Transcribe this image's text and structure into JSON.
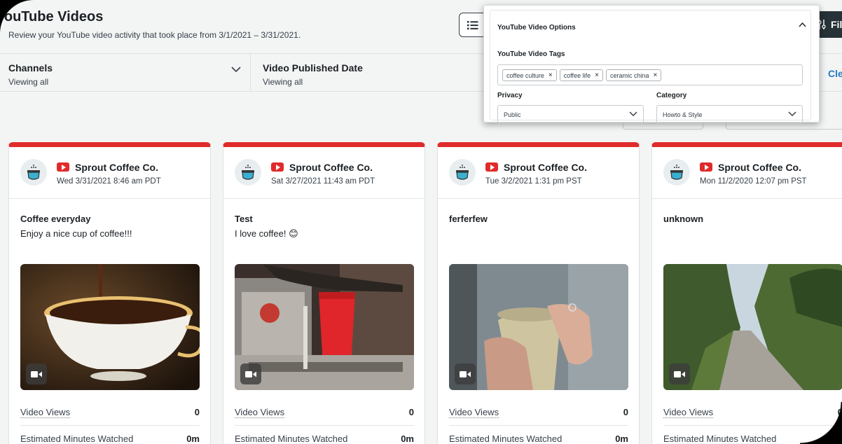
{
  "header": {
    "title": "YouTube Videos",
    "subtitle": "Review your YouTube video activity that took place from 3/1/2021 – 3/31/2021.",
    "filter_label": "Fil"
  },
  "filters": {
    "channels_label": "Channels",
    "channels_value": "Viewing all",
    "date_label": "Video Published Date",
    "date_value": "Viewing all",
    "clear_label": "Cle"
  },
  "options_panel": {
    "title": "YouTube Video Options",
    "tags_label": "YouTube Video Tags",
    "tags": [
      "coffee culture",
      "coffee life",
      "ceramic china"
    ],
    "privacy_label": "Privacy",
    "privacy_value": "Public",
    "category_label": "Category",
    "category_value": "Howto & Style"
  },
  "cards": [
    {
      "account": "Sprout Coffee Co.",
      "date": "Wed 3/31/2021 8:46 am PDT",
      "title": "Coffee everyday",
      "description": "Enjoy a nice cup of coffee!!!",
      "thumbnail": "coffee-cup",
      "views_label": "Video Views",
      "views": "0",
      "minutes_label": "Estimated Minutes Watched",
      "minutes": "0m"
    },
    {
      "account": "Sprout Coffee Co.",
      "date": "Sat 3/27/2021 11:43 am PDT",
      "title": "Test",
      "description": "I love coffee! 😊",
      "thumbnail": "espresso-machine",
      "views_label": "Video Views",
      "views": "0",
      "minutes_label": "Estimated Minutes Watched",
      "minutes": "0m"
    },
    {
      "account": "Sprout Coffee Co.",
      "date": "Tue 3/2/2021 1:31 pm PST",
      "title": "ferferfew",
      "description": "",
      "thumbnail": "hands-mug",
      "views_label": "Video Views",
      "views": "0",
      "minutes_label": "Estimated Minutes Watched",
      "minutes": "0m"
    },
    {
      "account": "Sprout Coffee Co.",
      "date": "Mon 11/2/2020 12:07 pm PST",
      "title": "unknown",
      "description": "",
      "thumbnail": "forest-road",
      "views_label": "Video Views",
      "views": "0",
      "minutes_label": "Estimated Minutes Watched",
      "minutes": "0m"
    }
  ],
  "colors": {
    "accent_red": "#e02b2b",
    "link_blue": "#2779c4",
    "dark_button": "#273238"
  }
}
